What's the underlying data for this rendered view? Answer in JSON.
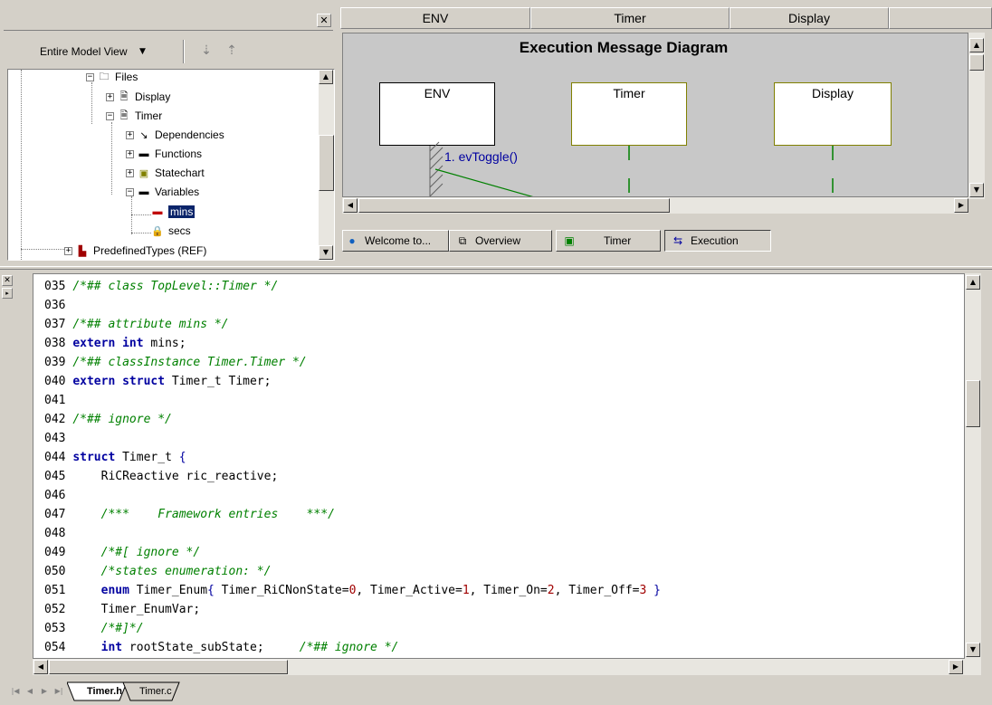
{
  "browser": {
    "view_label": "Entire Model View",
    "tree": [
      {
        "label": "Files"
      },
      {
        "label": "Display"
      },
      {
        "label": "Timer"
      },
      {
        "label": "Dependencies"
      },
      {
        "label": "Functions"
      },
      {
        "label": "Statechart"
      },
      {
        "label": "Variables"
      },
      {
        "label": "mins"
      },
      {
        "label": "secs"
      },
      {
        "label": "PredefinedTypes (REF)"
      }
    ]
  },
  "diagram": {
    "header": [
      "ENV",
      "Timer",
      "Display"
    ],
    "title": "Execution Message Diagram",
    "lifelines": [
      "ENV",
      "Timer",
      "Display"
    ],
    "message": "1. evToggle()",
    "tabs": [
      "Welcome to...",
      "Overview",
      "Timer",
      "Execution"
    ]
  },
  "editor": {
    "lines": [
      {
        "n": "035",
        "segs": [
          [
            "cm",
            "/*## class TopLevel::Timer */"
          ]
        ]
      },
      {
        "n": "036",
        "segs": []
      },
      {
        "n": "037",
        "segs": [
          [
            "cm",
            "/*## attribute mins */"
          ]
        ]
      },
      {
        "n": "038",
        "segs": [
          [
            "kw",
            "extern"
          ],
          [
            "t",
            " "
          ],
          [
            "kw",
            "int"
          ],
          [
            "t",
            " mins;"
          ]
        ]
      },
      {
        "n": "039",
        "segs": [
          [
            "cm",
            "/*## classInstance Timer.Timer */"
          ]
        ]
      },
      {
        "n": "040",
        "segs": [
          [
            "kw",
            "extern"
          ],
          [
            "t",
            " "
          ],
          [
            "kw",
            "struct"
          ],
          [
            "t",
            " Timer_t Timer;"
          ]
        ]
      },
      {
        "n": "041",
        "segs": []
      },
      {
        "n": "042",
        "segs": [
          [
            "cm",
            "/*## ignore */"
          ]
        ]
      },
      {
        "n": "043",
        "segs": []
      },
      {
        "n": "044",
        "segs": [
          [
            "kw",
            "struct"
          ],
          [
            "t",
            " Timer_t "
          ],
          [
            "br",
            "{"
          ]
        ]
      },
      {
        "n": "045",
        "segs": [
          [
            "t",
            "    RiCReactive ric_reactive;"
          ]
        ]
      },
      {
        "n": "046",
        "segs": []
      },
      {
        "n": "047",
        "segs": [
          [
            "t",
            "    "
          ],
          [
            "cm",
            "/***    Framework entries    ***/"
          ]
        ]
      },
      {
        "n": "048",
        "segs": []
      },
      {
        "n": "049",
        "segs": [
          [
            "t",
            "    "
          ],
          [
            "cm",
            "/*#[ ignore */"
          ]
        ]
      },
      {
        "n": "050",
        "segs": [
          [
            "t",
            "    "
          ],
          [
            "cm",
            "/*states enumeration: */"
          ]
        ]
      },
      {
        "n": "051",
        "segs": [
          [
            "t",
            "    "
          ],
          [
            "kw",
            "enum"
          ],
          [
            "t",
            " Timer_Enum"
          ],
          [
            "br",
            "{"
          ],
          [
            "t",
            " Timer_RiCNonState="
          ],
          [
            "num",
            "0"
          ],
          [
            "t",
            ", Timer_Active="
          ],
          [
            "num",
            "1"
          ],
          [
            "t",
            ", Timer_On="
          ],
          [
            "num",
            "2"
          ],
          [
            "t",
            ", Timer_Off="
          ],
          [
            "num",
            "3"
          ],
          [
            "t",
            " "
          ],
          [
            "br",
            "}"
          ]
        ]
      },
      {
        "n": "052",
        "segs": [
          [
            "t",
            "    Timer_EnumVar;"
          ]
        ]
      },
      {
        "n": "053",
        "segs": [
          [
            "t",
            "    "
          ],
          [
            "cm",
            "/*#]*/"
          ]
        ]
      },
      {
        "n": "054",
        "segs": [
          [
            "t",
            "    "
          ],
          [
            "kw",
            "int"
          ],
          [
            "t",
            " rootState_subState;     "
          ],
          [
            "cm",
            "/*## ignore */"
          ]
        ]
      }
    ],
    "file_tabs": [
      "Timer.h",
      "Timer.c"
    ]
  }
}
